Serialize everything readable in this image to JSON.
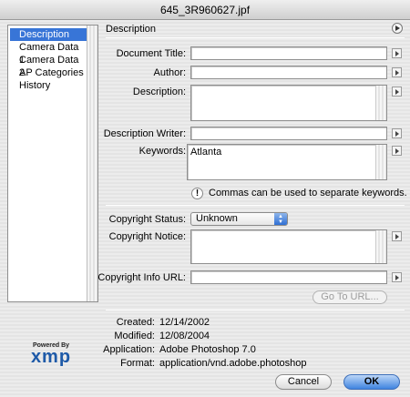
{
  "window": {
    "title": "645_3R960627.jpf"
  },
  "sidebar": {
    "items": [
      {
        "label": "Description",
        "selected": true
      },
      {
        "label": "Camera Data 1",
        "selected": false
      },
      {
        "label": "Camera Data 2",
        "selected": false
      },
      {
        "label": "AP Categories",
        "selected": false
      },
      {
        "label": "History",
        "selected": false
      }
    ]
  },
  "section": {
    "title": "Description"
  },
  "form": {
    "document_title": {
      "label": "Document Title:",
      "value": ""
    },
    "author": {
      "label": "Author:",
      "value": ""
    },
    "description": {
      "label": "Description:",
      "value": ""
    },
    "description_writer": {
      "label": "Description Writer:",
      "value": ""
    },
    "keywords": {
      "label": "Keywords:",
      "value": "Atlanta"
    },
    "keywords_notice": "Commas can be used to separate keywords.",
    "copyright_status": {
      "label": "Copyright Status:",
      "value": "Unknown"
    },
    "copyright_notice": {
      "label": "Copyright Notice:",
      "value": ""
    },
    "copyright_url": {
      "label": "Copyright Info URL:",
      "value": ""
    },
    "goto_button": "Go To URL..."
  },
  "info": {
    "created": {
      "label": "Created:",
      "value": "12/14/2002"
    },
    "modified": {
      "label": "Modified:",
      "value": "12/08/2004"
    },
    "application": {
      "label": "Application:",
      "value": "Adobe Photoshop 7.0"
    },
    "format": {
      "label": "Format:",
      "value": "application/vnd.adobe.photoshop"
    }
  },
  "logo": {
    "top": "Powered By",
    "main": "xmp"
  },
  "buttons": {
    "cancel": "Cancel",
    "ok": "OK"
  },
  "colors": {
    "selection": "#3875d7",
    "default_button": "#3f84e0"
  }
}
